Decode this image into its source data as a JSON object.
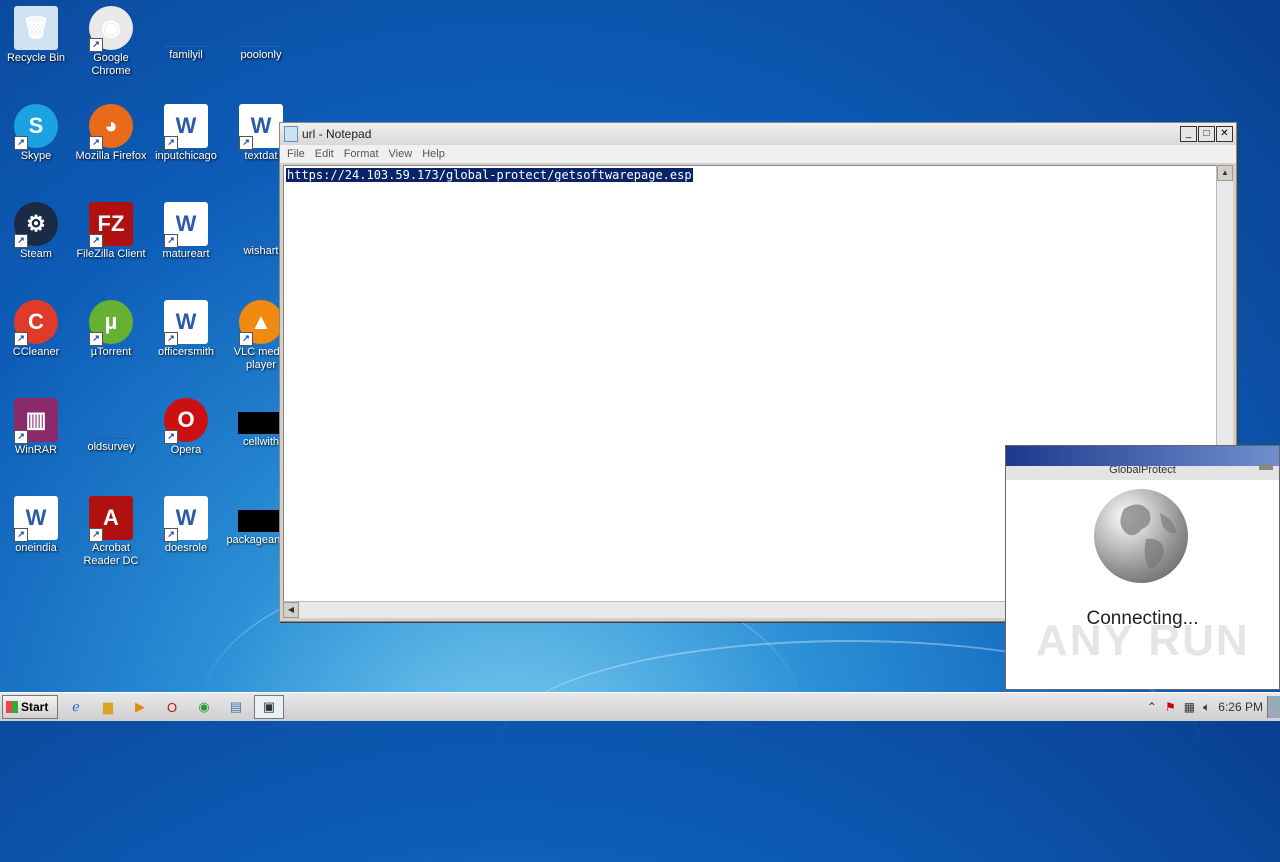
{
  "desktop": {
    "icons": [
      {
        "label": "Recycle Bin",
        "icon": "recycle-bin"
      },
      {
        "label": "Google Chrome",
        "icon": "chrome"
      },
      {
        "label": "familyil",
        "icon": "file"
      },
      {
        "label": "poolonly",
        "icon": "file"
      },
      {
        "label": "Skype",
        "icon": "skype"
      },
      {
        "label": "Mozilla Firefox",
        "icon": "firefox"
      },
      {
        "label": "inputchicago",
        "icon": "word-doc"
      },
      {
        "label": "textdat",
        "icon": "word-doc"
      },
      {
        "label": "Steam",
        "icon": "steam"
      },
      {
        "label": "FileZilla Client",
        "icon": "filezilla"
      },
      {
        "label": "matureart",
        "icon": "word-doc"
      },
      {
        "label": "wishart",
        "icon": "file"
      },
      {
        "label": "CCleaner",
        "icon": "ccleaner"
      },
      {
        "label": "µTorrent",
        "icon": "utorrent"
      },
      {
        "label": "officersmith",
        "icon": "word-doc"
      },
      {
        "label": "VLC media player",
        "icon": "vlc"
      },
      {
        "label": "WinRAR",
        "icon": "winrar"
      },
      {
        "label": "oldsurvey",
        "icon": "file"
      },
      {
        "label": "Opera",
        "icon": "opera"
      },
      {
        "label": "cellwith",
        "icon": "black-file"
      },
      {
        "label": "oneindia",
        "icon": "word-doc"
      },
      {
        "label": "Acrobat Reader DC",
        "icon": "acrobat"
      },
      {
        "label": "doesrole",
        "icon": "word-doc"
      },
      {
        "label": "packageana...",
        "icon": "black-file"
      }
    ]
  },
  "notepad": {
    "title": "url - Notepad",
    "menu": [
      "File",
      "Edit",
      "Format",
      "View",
      "Help"
    ],
    "content": "https://24.103.59.173/global-protect/getsoftwarepage.esp",
    "buttons": {
      "minimize": "_",
      "maximize": "□",
      "close": "✕"
    }
  },
  "globalprotect": {
    "title": "GlobalProtect",
    "status": "Connecting...",
    "watermark": "ANY RUN"
  },
  "taskbar": {
    "start_label": "Start",
    "clock": "6:26 PM",
    "items": [
      "ie",
      "explorer",
      "media-player",
      "opera",
      "chrome",
      "notepad",
      "globalprotect"
    ]
  }
}
